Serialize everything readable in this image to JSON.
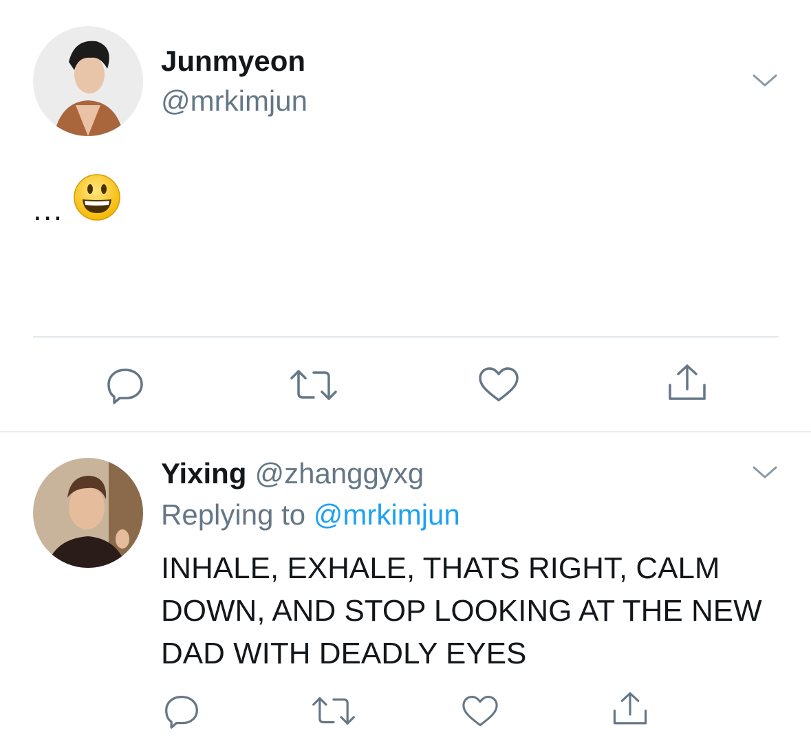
{
  "main_tweet": {
    "display_name": "Junmyeon",
    "handle": "@mrkimjun",
    "text": "...",
    "emoji": "grinning-face-emoji"
  },
  "reply_tweet": {
    "display_name": "Yixing",
    "handle": "@zhanggyxg",
    "replying_prefix": "Replying to",
    "replying_to": "@mrkimjun",
    "text": "INHALE, EXHALE, THATS RIGHT, CALM DOWN, AND STOP LOOKING AT THE NEW DAD WITH DEADLY EYES"
  },
  "icons": {
    "reply": "reply-icon",
    "retweet": "retweet-icon",
    "like": "heart-icon",
    "share": "share-icon",
    "menu": "chevron-down-icon"
  },
  "colors": {
    "text_primary": "#14171a",
    "text_secondary": "#657786",
    "link": "#1da1f2",
    "icon": "#657786",
    "divider": "#e1e8ed"
  }
}
